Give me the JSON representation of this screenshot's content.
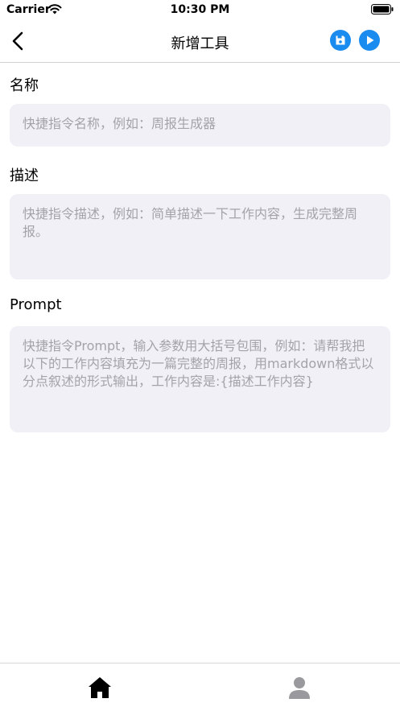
{
  "status_bar": {
    "carrier": "Carrier",
    "time": "10:30 PM"
  },
  "nav": {
    "title": "新增工具",
    "back_icon": "chevron-left-icon",
    "save_icon": "save-icon",
    "run_icon": "play-icon",
    "accent_color": "#1A8CF0"
  },
  "form": {
    "name": {
      "label": "名称",
      "placeholder": "快捷指令名称，例如：周报生成器"
    },
    "description": {
      "label": "描述",
      "placeholder": "快捷指令描述，例如：简单描述一下工作内容，生成完整周报。"
    },
    "prompt": {
      "label": "Prompt",
      "placeholder": "快捷指令Prompt，输入参数用大括号包围，例如：请帮我把以下的工作内容填充为一篇完整的周报，用markdown格式以分点叙述的形式输出，工作内容是:{描述工作内容}"
    }
  },
  "tab_bar": {
    "tabs": [
      {
        "icon": "home-icon",
        "selected": true
      },
      {
        "icon": "person-icon",
        "selected": false
      }
    ]
  }
}
